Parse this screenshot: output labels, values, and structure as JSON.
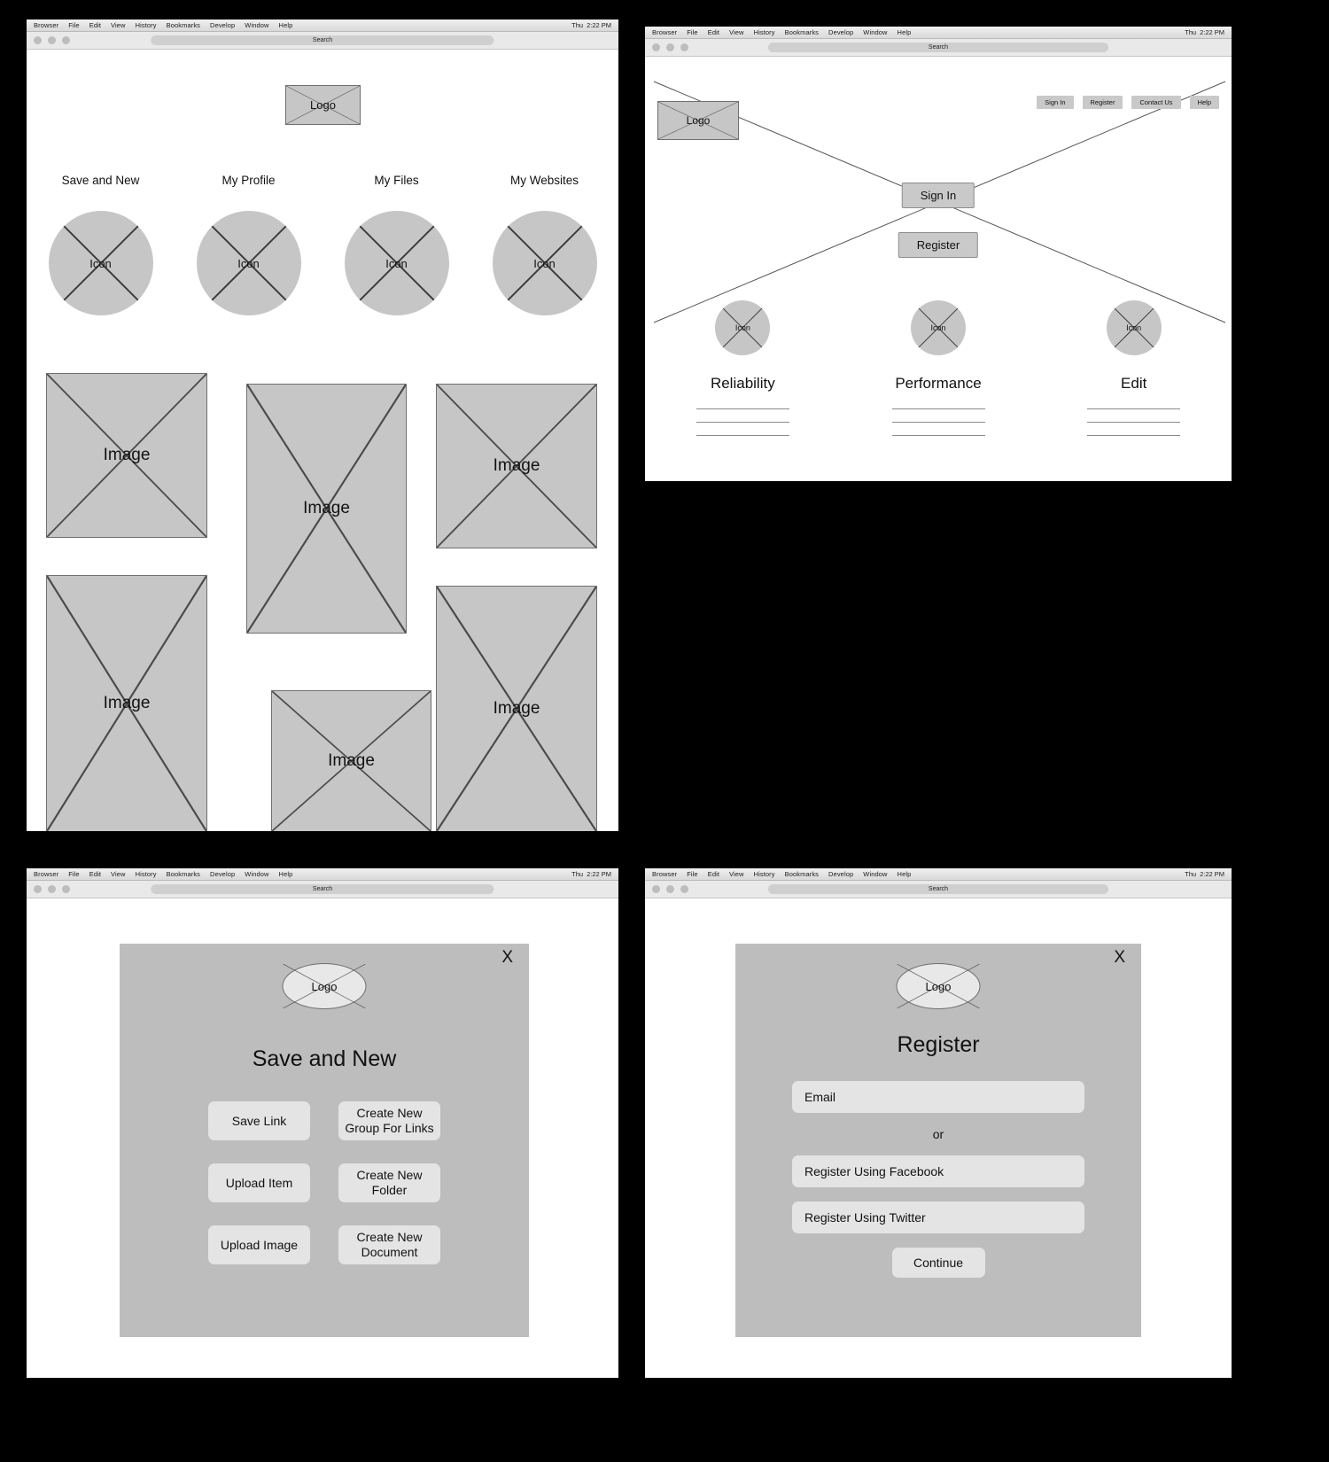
{
  "browser_chrome": {
    "menus": [
      "Browser",
      "File",
      "Edit",
      "View",
      "History",
      "Bookmarks",
      "Develop",
      "Window",
      "Help"
    ],
    "clock_day": "Thu",
    "clock_time": "2:22 PM",
    "search_label": "Search",
    "traffic_lights": [
      "close-light",
      "minimize-light",
      "zoom-light"
    ]
  },
  "placeholders": {
    "logo": "Logo",
    "icon": "Icon",
    "image": "Image"
  },
  "dashboard": {
    "logo_label": "Logo",
    "nav_items": [
      {
        "label": "Save and New",
        "icon_label": "Icon"
      },
      {
        "label": "My Profile",
        "icon_label": "Icon"
      },
      {
        "label": "My Files",
        "icon_label": "Icon"
      },
      {
        "label": "My Websites",
        "icon_label": "Icon"
      }
    ],
    "images": [
      {
        "label": "Image"
      },
      {
        "label": "Image"
      },
      {
        "label": "Image"
      },
      {
        "label": "Image"
      },
      {
        "label": "Image"
      },
      {
        "label": "Image"
      }
    ]
  },
  "landing": {
    "logo_label": "Logo",
    "top_nav": [
      "Sign In",
      "Register",
      "Contact Us",
      "Help"
    ],
    "center_buttons": {
      "sign_in": "Sign In",
      "register": "Register"
    },
    "features": [
      {
        "icon_label": "Icon",
        "title": "Reliability",
        "line_count": 3
      },
      {
        "icon_label": "Icon",
        "title": "Performance",
        "line_count": 3
      },
      {
        "icon_label": "Icon",
        "title": "Edit",
        "line_count": 3
      }
    ]
  },
  "save_new_modal": {
    "close_label": "X",
    "logo_label": "Logo",
    "title": "Save and New",
    "buttons": [
      "Save Link",
      "Create New Group For Links",
      "Upload Item",
      "Create New Folder",
      "Upload Image",
      "Create New Document"
    ]
  },
  "register_modal": {
    "close_label": "X",
    "logo_label": "Logo",
    "title": "Register",
    "email_field": "Email",
    "divider": "or",
    "facebook_button": "Register Using Facebook",
    "twitter_button": "Register Using Twitter",
    "continue_button": "Continue"
  },
  "colors": {
    "background": "#000000",
    "window": "#ffffff",
    "placeholder_fill": "#c6c6c6",
    "modal_fill": "#bdbdbd",
    "control_fill": "#e4e4e4"
  }
}
